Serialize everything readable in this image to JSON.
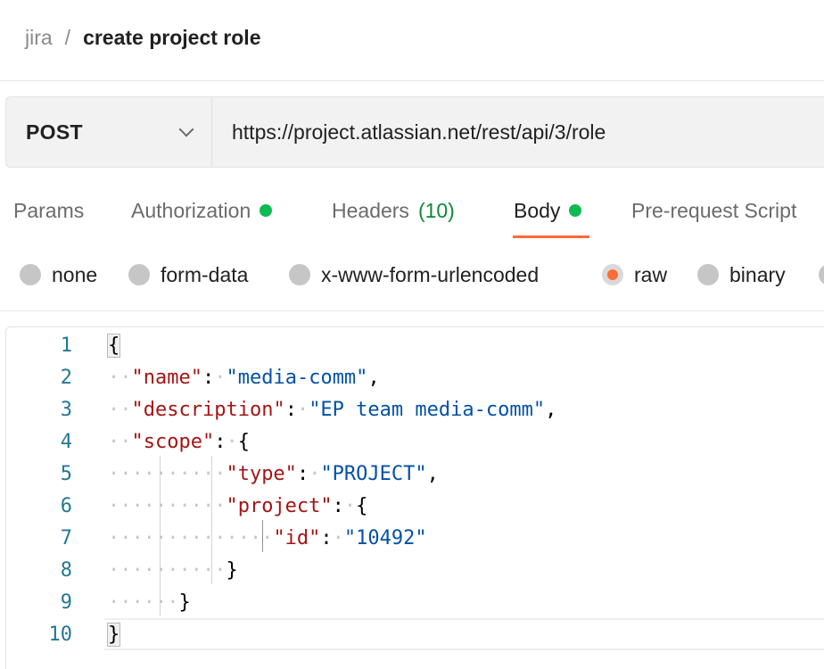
{
  "breadcrumb": {
    "parent": "jira",
    "separator": "/",
    "current": "create project role"
  },
  "request": {
    "method": "POST",
    "url": "https://project.atlassian.net/rest/api/3/role"
  },
  "tabs": {
    "params": "Params",
    "authorization": "Authorization",
    "headers": "Headers",
    "headers_count": "(10)",
    "body": "Body",
    "prerequest": "Pre-request Script",
    "active": "Body"
  },
  "body_types": {
    "none": "none",
    "form_data": "form-data",
    "urlencoded": "x-www-form-urlencoded",
    "raw": "raw",
    "binary": "binary",
    "selected": "raw"
  },
  "editor": {
    "line_numbers": [
      "1",
      "2",
      "3",
      "4",
      "5",
      "6",
      "7",
      "8",
      "9",
      "10"
    ],
    "open_brace": "{",
    "close_brace": "}",
    "name_key": "\"name\"",
    "name_value": "\"media-comm\"",
    "description_key": "\"description\"",
    "description_value": "\"EP team media-comm\"",
    "scope_key": "\"scope\"",
    "type_key": "\"type\"",
    "type_value": "\"PROJECT\"",
    "project_key": "\"project\"",
    "id_key": "\"id\"",
    "id_value": "\"10492\"",
    "colon": ":",
    "comma": ","
  },
  "colors": {
    "accent": "#ff6c37",
    "status_green": "#0cbb52",
    "json_key": "#a31515",
    "json_string": "#0451a5",
    "line_number": "#237893"
  }
}
